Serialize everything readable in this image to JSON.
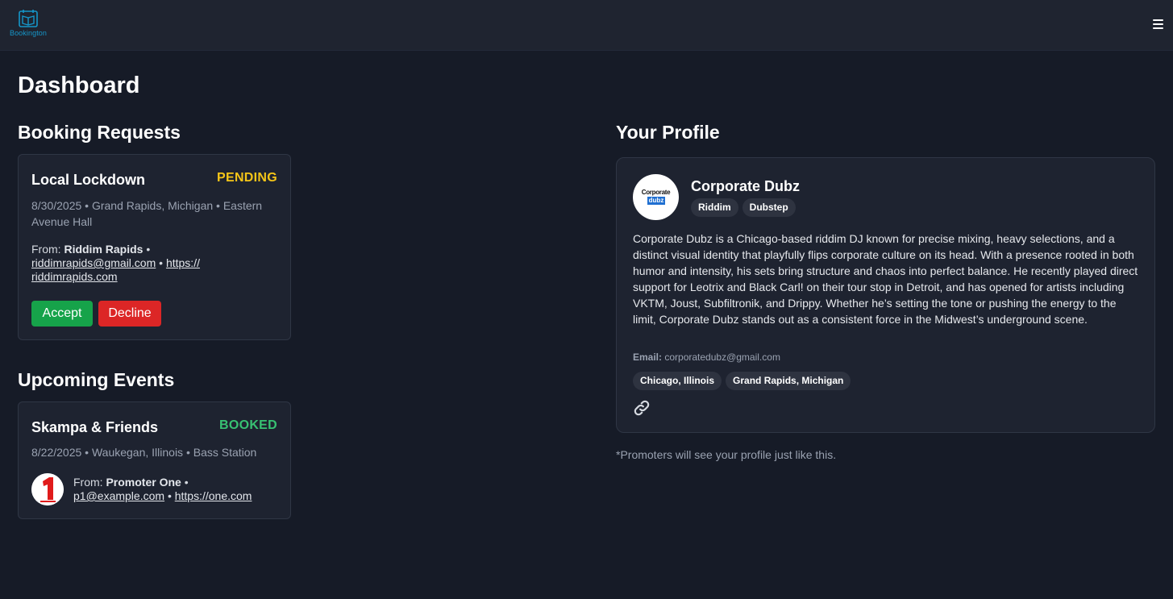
{
  "header": {
    "logo_text": "Bookington",
    "menu_icon": "hamburger-icon"
  },
  "page": {
    "title": "Dashboard"
  },
  "booking_requests": {
    "heading": "Booking Requests",
    "items": [
      {
        "title": "Local Lockdown",
        "status": "PENDING",
        "status_color": "#f5c518",
        "meta": "8/30/2025 • Grand Rapids, Michigan • Eastern Avenue Hall",
        "from_label": "From:",
        "from_name": "Riddim Rapids",
        "sep": "•",
        "email": "riddimrapids@gmail.com",
        "website": "https:// riddimrapids.com",
        "accept_label": "Accept",
        "decline_label": "Decline"
      }
    ]
  },
  "upcoming_events": {
    "heading": "Upcoming Events",
    "items": [
      {
        "title": "Skampa & Friends",
        "status": "BOOKED",
        "status_color": "#38c172",
        "meta": "8/22/2025 • Waukegan, Illinois • Bass Station",
        "from_label": "From:",
        "from_name": "Promoter One",
        "sep": "•",
        "email": "p1@example.com",
        "website": "https://one.com"
      }
    ]
  },
  "profile": {
    "heading": "Your Profile",
    "name": "Corporate Dubz",
    "avatar_text_top": "Corporate",
    "avatar_text_bottom": "dubz",
    "genres": [
      "Riddim",
      "Dubstep"
    ],
    "bio": "Corporate Dubz is a Chicago-based riddim DJ known for precise mixing, heavy selections, and a distinct visual identity that playfully flips corporate culture on its head. With a presence rooted in both humor and intensity, his sets bring structure and chaos into perfect balance. He recently played direct support for Leotrix and Black Carl! on their tour stop in Detroit, and has opened for artists including VKTM, Joust, Subfiltronik, and Drippy. Whether he’s setting the tone or pushing the energy to the limit, Corporate Dubz stands out as a consistent force in the Midwest’s underground scene.",
    "email_label": "Email:",
    "email": "corporatedubz@gmail.com",
    "locations": [
      "Chicago, Illinois",
      "Grand Rapids, Michigan"
    ],
    "link_icon": "link-icon",
    "note": "*Promoters will see your profile just like this."
  },
  "colors": {
    "accept": "#16a34a",
    "decline": "#dc2626",
    "brand": "#1596c9"
  }
}
